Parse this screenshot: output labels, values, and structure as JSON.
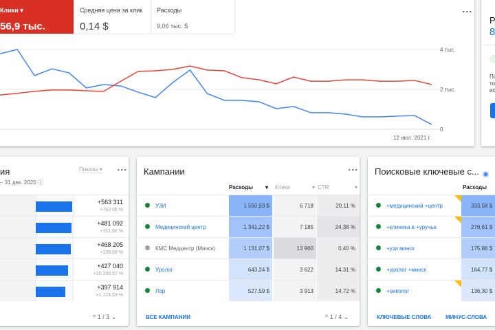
{
  "metrics": [
    {
      "label": "Клики",
      "value": "56,9 тыс.",
      "active": true
    },
    {
      "label": "Средняя цена за клик",
      "value": "0,14 $"
    },
    {
      "label": "Расходы",
      "value": "9,06 тыс. $"
    }
  ],
  "chart_data": {
    "type": "line",
    "title": "",
    "xlabel": "",
    "ylabel": "",
    "ylim": [
      0,
      4000
    ],
    "y_ticks": [
      "4 тыс.",
      "2 тыс.",
      "0"
    ],
    "x_last_label": "12 июл. 2021 г.",
    "series": [
      {
        "name": "Клики",
        "color": "#4285f4",
        "values": [
          3790,
          4000,
          2690,
          3030,
          2830,
          2070,
          2240,
          2170,
          1860,
          1590,
          2340,
          2970,
          1790,
          1450,
          1450,
          1380,
          1030,
          1140,
          830,
          830,
          760,
          620,
          620,
          660,
          690,
          240
        ]
      },
      {
        "name": "Средняя цена за клик",
        "color": "#ea4335",
        "values": [
          1720,
          1800,
          1900,
          1970,
          1970,
          1930,
          1900,
          2410,
          2900,
          2930,
          3000,
          3170,
          2970,
          2930,
          2590,
          2480,
          2280,
          2620,
          2410,
          2410,
          2480,
          2480,
          2410,
          2410,
          2450,
          2240
        ]
      }
    ]
  },
  "right_card": {
    "title": "Ре",
    "value": "8",
    "text": [
      "По",
      "то",
      "ис"
    ]
  },
  "changes": {
    "title": "ия",
    "date": "– 31 дек. 2020",
    "dropdown": "Показы",
    "rows": [
      {
        "value": "+563 311",
        "pct": "+792,06 %",
        "bar": 1.0
      },
      {
        "value": "+481 092",
        "pct": "+151,66 %",
        "bar": 0.98
      },
      {
        "value": "+468 205",
        "pct": "+138,50 %",
        "bar": 0.96
      },
      {
        "value": "+427 040",
        "pct": "+20 200,57 %",
        "bar": 0.88
      },
      {
        "value": "+397 914",
        "pct": "+1 124,53 %",
        "bar": 0.82
      }
    ],
    "pagination": "1 / 3"
  },
  "campaigns": {
    "title": "Кампании",
    "columns": [
      "Расходы",
      "Клики",
      "CTR"
    ],
    "rows": [
      {
        "name": "УЗИ",
        "status": "#188038",
        "cost": "1 550,93 $",
        "clicks": "6 718",
        "ctr": "20,11 %"
      },
      {
        "name": "Медицинский центр",
        "status": "#188038",
        "cost": "1 341,22 $",
        "clicks": "7 185",
        "ctr": "24,38 %"
      },
      {
        "name": "КМС Медцентр (Минск)",
        "status": "#9aa0a6",
        "cost": "1 131,07 $",
        "clicks": "13 960",
        "ctr": "0,40 %"
      },
      {
        "name": "Уролог",
        "status": "#188038",
        "cost": "643,24 $",
        "clicks": "3 622",
        "ctr": "14,31 %"
      },
      {
        "name": "Лор",
        "status": "#188038",
        "cost": "527,59 $",
        "clicks": "3 913",
        "ctr": "14,72 %"
      }
    ],
    "footer_link": "ВСЕ КАМПАНИИ",
    "pagination": "1 / 4"
  },
  "keywords": {
    "title": "Поисковые ключевые с...",
    "column": "Расходы",
    "rows": [
      {
        "name": "+медицинский +центр",
        "cost": "333,58 $",
        "flag": true
      },
      {
        "name": "+клиника в +уручье",
        "cost": "276,61 $",
        "flag": true
      },
      {
        "name": "+узи минск",
        "cost": "175,88 $",
        "flag": false
      },
      {
        "name": "+уролог +минск",
        "cost": "164,77 $",
        "flag": false
      },
      {
        "name": "+онколог",
        "cost": "136,30 $",
        "flag": true
      }
    ],
    "links": [
      "КЛЮЧЕВЫЕ СЛОВА",
      "МИНУС-СЛОВА"
    ]
  }
}
